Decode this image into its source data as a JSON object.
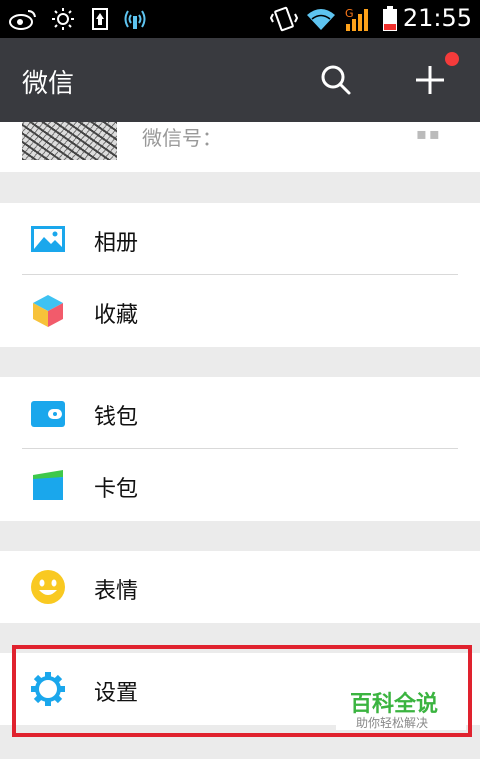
{
  "status_bar": {
    "time": "21:55",
    "signal_label": "G",
    "icons": [
      "weibo-icon",
      "brightness-icon",
      "usb-icon",
      "wireless-debug-icon",
      "vibrate-icon",
      "wifi-icon",
      "signal-icon",
      "battery-icon"
    ],
    "battery_color": "#f0302d"
  },
  "app_bar": {
    "title": "微信",
    "search_icon": "search-icon",
    "add_icon": "plus-icon",
    "badge_color": "#f43b3b"
  },
  "profile": {
    "wxid_label": "微信号："
  },
  "menu": {
    "album": {
      "label": "相册",
      "icon": "album-icon"
    },
    "favorites": {
      "label": "收藏",
      "icon": "favorites-cube-icon"
    },
    "wallet": {
      "label": "钱包",
      "icon": "wallet-icon"
    },
    "cards": {
      "label": "卡包",
      "icon": "card-package-icon"
    },
    "stickers": {
      "label": "表情",
      "icon": "smiley-icon"
    },
    "settings": {
      "label": "设置",
      "icon": "gear-icon"
    }
  },
  "watermark": {
    "title": "百科全说",
    "subtitle": "助你轻松解决"
  },
  "colors": {
    "app_bar_bg": "#393a3f",
    "accent_blue": "#1aa7ec",
    "highlight_red": "#e0222e",
    "watermark_green": "#3bb440"
  }
}
